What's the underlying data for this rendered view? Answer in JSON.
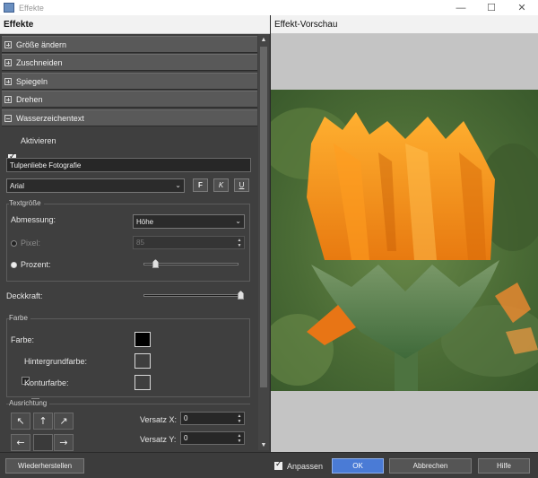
{
  "window": {
    "title": "Effekte",
    "minimize": "—",
    "maximize": "☐",
    "close": "✕"
  },
  "left_panel": {
    "header": "Effekte",
    "sections": [
      {
        "label": "Größe ändern",
        "expanded": false
      },
      {
        "label": "Zuschneiden",
        "expanded": false
      },
      {
        "label": "Spiegeln",
        "expanded": false
      },
      {
        "label": "Drehen",
        "expanded": false
      },
      {
        "label": "Wasserzeichentext",
        "expanded": true
      }
    ],
    "watermark": {
      "activate_label": "Aktivieren",
      "activate_checked": true,
      "text_value": "Tulpenliebe Fotografie",
      "font_value": "Arial",
      "bold_label": "F",
      "italic_label": "K",
      "underline_label": "U",
      "text_size": {
        "group_title": "Textgröße",
        "dimension_label": "Abmessung:",
        "dimension_value": "Höhe",
        "pixel_label": "Pixel:",
        "pixel_value": "85",
        "percent_label": "Prozent:",
        "percent_selected": true,
        "percent_level": 0.1
      },
      "opacity_label": "Deckkraft:",
      "opacity_level": 1.0,
      "color": {
        "group_title": "Farbe",
        "color_label": "Farbe:",
        "color_value": "#000000",
        "background_label": "Hintergrundfarbe:",
        "background_checked": false,
        "outline_label": "Konturfarbe:",
        "outline_checked": false
      },
      "alignment": {
        "group_title": "Ausrichtung",
        "arrows": [
          "↖",
          "↑",
          "↗",
          "←",
          "",
          "→"
        ],
        "offset_x_label": "Versatz X:",
        "offset_x_value": "0",
        "offset_y_label": "Versatz Y:",
        "offset_y_value": "0"
      }
    }
  },
  "preview": {
    "header": "Effekt-Vorschau"
  },
  "footer": {
    "restore_label": "Wiederherstellen",
    "fit_label": "Anpassen",
    "fit_checked": true,
    "ok_label": "OK",
    "cancel_label": "Abbrechen",
    "help_label": "Hilfe"
  },
  "colors": {
    "accent": "#4a7bd6",
    "flower": "#f59a1a",
    "leaves": "#4d7a3a"
  }
}
